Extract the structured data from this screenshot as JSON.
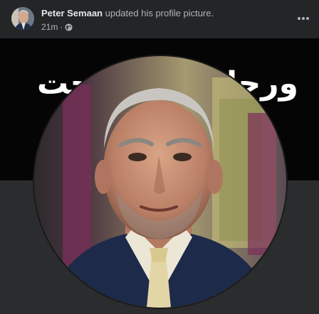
{
  "post": {
    "author_name": "Peter Semaan",
    "action_text": " updated his profile picture.",
    "time_ago": "21m",
    "separator": "·",
    "privacy_icon": "globe-icon",
    "more_icon": "more-horizontal-icon"
  },
  "cover": {
    "text_left": "حت",
    "text_right": "ورحا"
  },
  "colors": {
    "background": "#242526",
    "cover": "#050505",
    "text_primary": "#e4e6eb",
    "text_secondary": "#b0b3b8"
  }
}
